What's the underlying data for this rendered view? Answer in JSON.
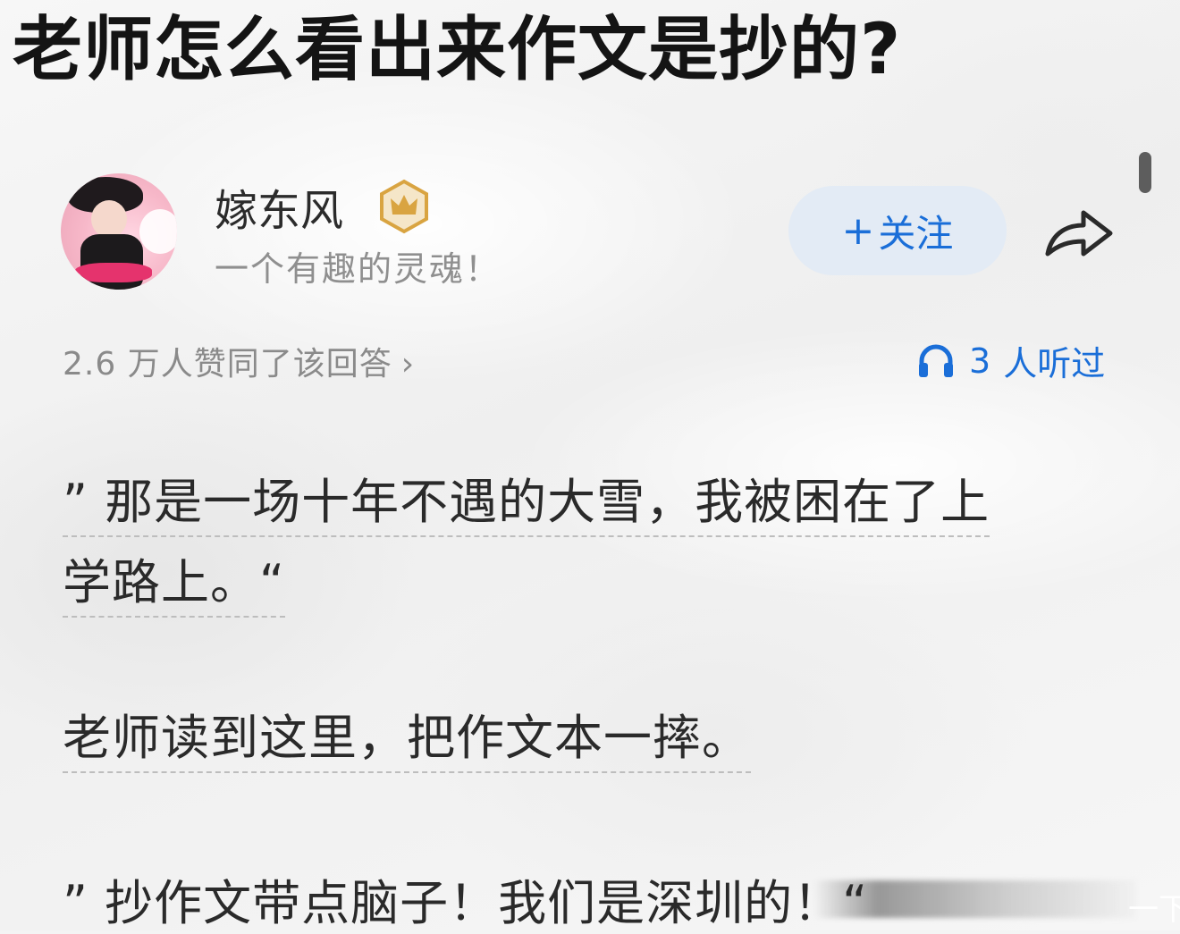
{
  "question": {
    "title": "老师怎么看出来作文是抄的?"
  },
  "author": {
    "name": "嫁东风",
    "bio": "一个有趣的灵魂！",
    "badge_icon": "crown-badge-icon",
    "avatar_icon": "avatar-photo"
  },
  "actions": {
    "follow_plus": "+",
    "follow_label": "关注",
    "share_icon": "share-arrow-icon"
  },
  "stats": {
    "approval_text": "2.6 万人赞同了该回答",
    "approval_chevron": "›",
    "listen_count": "3",
    "listen_suffix": "人听过"
  },
  "answer": {
    "p1_line1": "” 那是一场十年不遇的大雪，我被困在了上",
    "p1_line2": "学路上。“",
    "p2_line1": "老师读到这里，把作文本一摔。",
    "p3_line1": "” 抄作文带点脑子！我们是深圳的！“"
  },
  "footer": {
    "next_label": "一下"
  },
  "colors": {
    "accent": "#1a6ed8",
    "follow_bg": "#e1eaf5",
    "muted_text": "#8a8a8a",
    "badge_gold": "#d9a441"
  }
}
